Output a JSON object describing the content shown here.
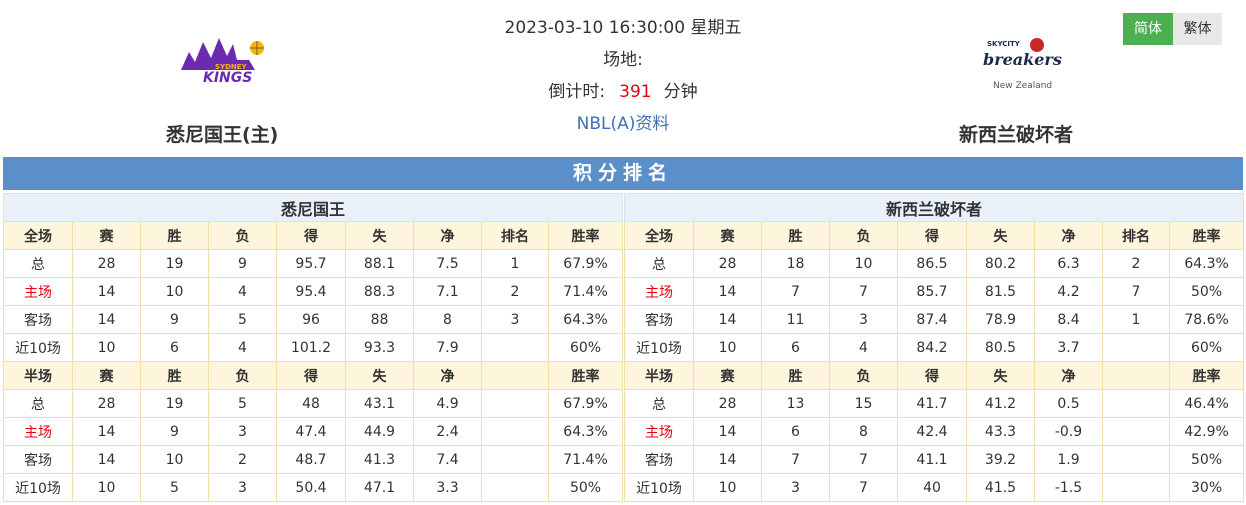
{
  "match": {
    "datetime": "2023-03-10 16:30:00 星期五",
    "venue_label": "场地:",
    "countdown_label": "倒计时:",
    "countdown_value": "391",
    "countdown_unit": "分钟",
    "league_link": "NBL(A)资料"
  },
  "home": {
    "name": "悉尼国王(主)",
    "logo_text": [
      "SYDNEY",
      "KINGS"
    ],
    "logo_colors": {
      "primary": "#6a2bb0",
      "accent": "#f2b51c"
    }
  },
  "away": {
    "name": "新西兰破坏者",
    "logo_text": [
      "SKYCITY",
      "breakers",
      "New Zealand"
    ],
    "logo_colors": {
      "primary": "#1b2a4a",
      "accent": "#c62828"
    }
  },
  "lang": {
    "simplified": "简体",
    "traditional": "繁体"
  },
  "standings": {
    "title": "积分排名",
    "full_header": [
      "全场",
      "赛",
      "胜",
      "负",
      "得",
      "失",
      "净",
      "排名",
      "胜率"
    ],
    "half_header": [
      "半场",
      "赛",
      "胜",
      "负",
      "得",
      "失",
      "净",
      "",
      "胜率"
    ],
    "home": {
      "team": "悉尼国王",
      "full": [
        [
          "总",
          "28",
          "19",
          "9",
          "95.7",
          "88.1",
          "7.5",
          "1",
          "67.9%"
        ],
        [
          "主场",
          "14",
          "10",
          "4",
          "95.4",
          "88.3",
          "7.1",
          "2",
          "71.4%"
        ],
        [
          "客场",
          "14",
          "9",
          "5",
          "96",
          "88",
          "8",
          "3",
          "64.3%"
        ],
        [
          "近10场",
          "10",
          "6",
          "4",
          "101.2",
          "93.3",
          "7.9",
          "",
          "60%"
        ]
      ],
      "half": [
        [
          "总",
          "28",
          "19",
          "5",
          "48",
          "43.1",
          "4.9",
          "",
          "67.9%"
        ],
        [
          "主场",
          "14",
          "9",
          "3",
          "47.4",
          "44.9",
          "2.4",
          "",
          "64.3%"
        ],
        [
          "客场",
          "14",
          "10",
          "2",
          "48.7",
          "41.3",
          "7.4",
          "",
          "71.4%"
        ],
        [
          "近10场",
          "10",
          "5",
          "3",
          "50.4",
          "47.1",
          "3.3",
          "",
          "50%"
        ]
      ]
    },
    "away": {
      "team": "新西兰破坏者",
      "full": [
        [
          "总",
          "28",
          "18",
          "10",
          "86.5",
          "80.2",
          "6.3",
          "2",
          "64.3%"
        ],
        [
          "主场",
          "14",
          "7",
          "7",
          "85.7",
          "81.5",
          "4.2",
          "7",
          "50%"
        ],
        [
          "客场",
          "14",
          "11",
          "3",
          "87.4",
          "78.9",
          "8.4",
          "1",
          "78.6%"
        ],
        [
          "近10场",
          "10",
          "6",
          "4",
          "84.2",
          "80.5",
          "3.7",
          "",
          "60%"
        ]
      ],
      "half": [
        [
          "总",
          "28",
          "13",
          "15",
          "41.7",
          "41.2",
          "0.5",
          "",
          "46.4%"
        ],
        [
          "主场",
          "14",
          "6",
          "8",
          "42.4",
          "43.3",
          "-0.9",
          "",
          "42.9%"
        ],
        [
          "客场",
          "14",
          "7",
          "7",
          "41.1",
          "39.2",
          "1.9",
          "",
          "50%"
        ],
        [
          "近10场",
          "10",
          "3",
          "7",
          "40",
          "41.5",
          "-1.5",
          "",
          "30%"
        ]
      ]
    }
  }
}
